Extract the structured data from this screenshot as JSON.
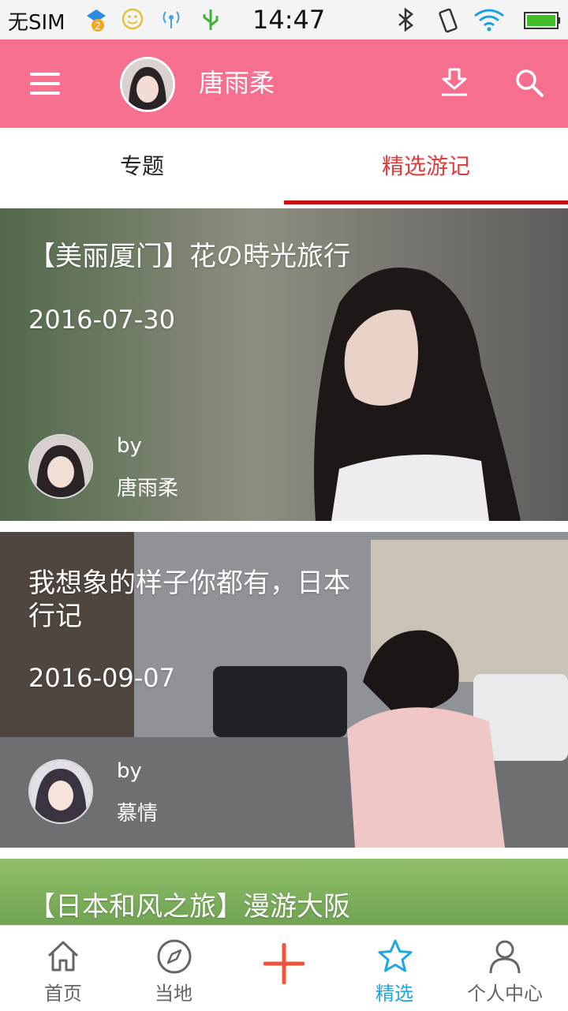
{
  "status": {
    "carrier": "无SIM",
    "badge_count": "2",
    "time": "14:47"
  },
  "header": {
    "username": "唐雨柔",
    "menu_icon": "menu-icon",
    "download_icon": "download-icon",
    "search_icon": "search-icon"
  },
  "tabs": [
    {
      "label": "专题"
    },
    {
      "label": "精选游记"
    }
  ],
  "cards": [
    {
      "title": "【美丽厦门】花の時光旅行",
      "date": "2016-07-30",
      "by": "by",
      "author": "唐雨柔"
    },
    {
      "title": "我想象的样子你都有，日本行记",
      "date": "2016-09-07",
      "by": "by",
      "author": "慕情"
    },
    {
      "title": "【日本和风之旅】漫游大阪"
    }
  ],
  "nav": [
    {
      "label": "首页",
      "icon": "home-icon"
    },
    {
      "label": "当地",
      "icon": "compass-icon"
    },
    {
      "label": "",
      "icon": "plus-icon"
    },
    {
      "label": "精选",
      "icon": "star-icon"
    },
    {
      "label": "个人中心",
      "icon": "user-icon"
    }
  ],
  "colors": {
    "header_bg": "#f76f8e",
    "active_tab": "#e23b3b",
    "tab_indicator": "#c91010",
    "active_nav": "#1da6e8",
    "plus": "#f0533a"
  }
}
